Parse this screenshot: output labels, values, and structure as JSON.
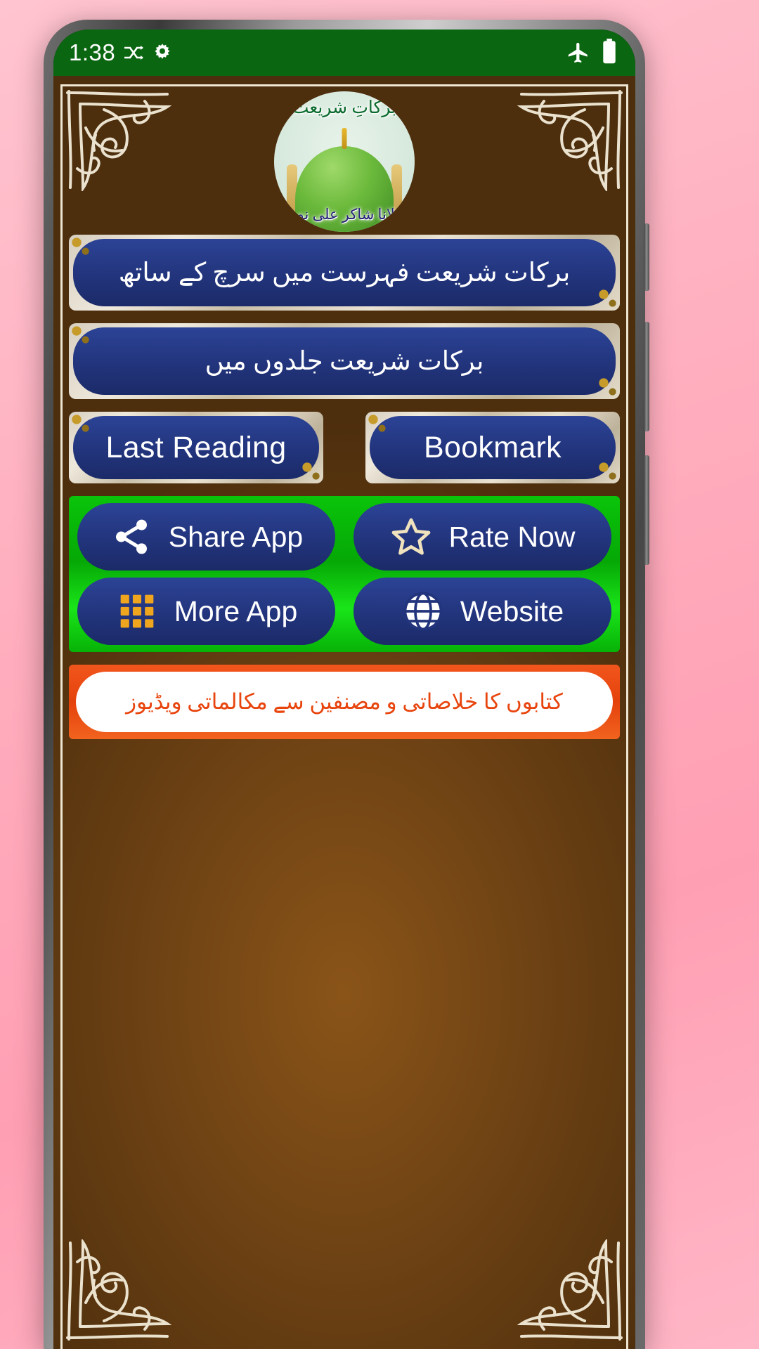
{
  "statusbar": {
    "time": "1:38",
    "icons_left": [
      "shuffle-icon",
      "gear-icon"
    ],
    "icons_right": [
      "airplane-mode-icon",
      "battery-full-icon"
    ],
    "background_color": "#0b6611"
  },
  "app": {
    "logo": {
      "title_urdu": "برکاتِ شریعت",
      "subtitle_urdu": "مولانا شاکر علی نوری",
      "image": "green-dome-madina-icon"
    },
    "buttons": {
      "search_index": "برکات شریعت فہرست میں سرچ کے ساتھ",
      "volumes": "برکات شریعت جلدوں میں",
      "last_reading": "Last Reading",
      "bookmark": "Bookmark",
      "share_app": "Share App",
      "rate_now": "Rate Now",
      "more_app": "More App",
      "website": "Website"
    },
    "video_banner": "کتابوں کا خلاصاتی و مصنفین سے مکالماتی ویڈیوز",
    "colors": {
      "blue_button": "#22347c",
      "green_panel": "#07b207",
      "red_banner": "#e8440d",
      "background_brown": "#6f4314",
      "frame_cream": "#efe6d2"
    }
  }
}
